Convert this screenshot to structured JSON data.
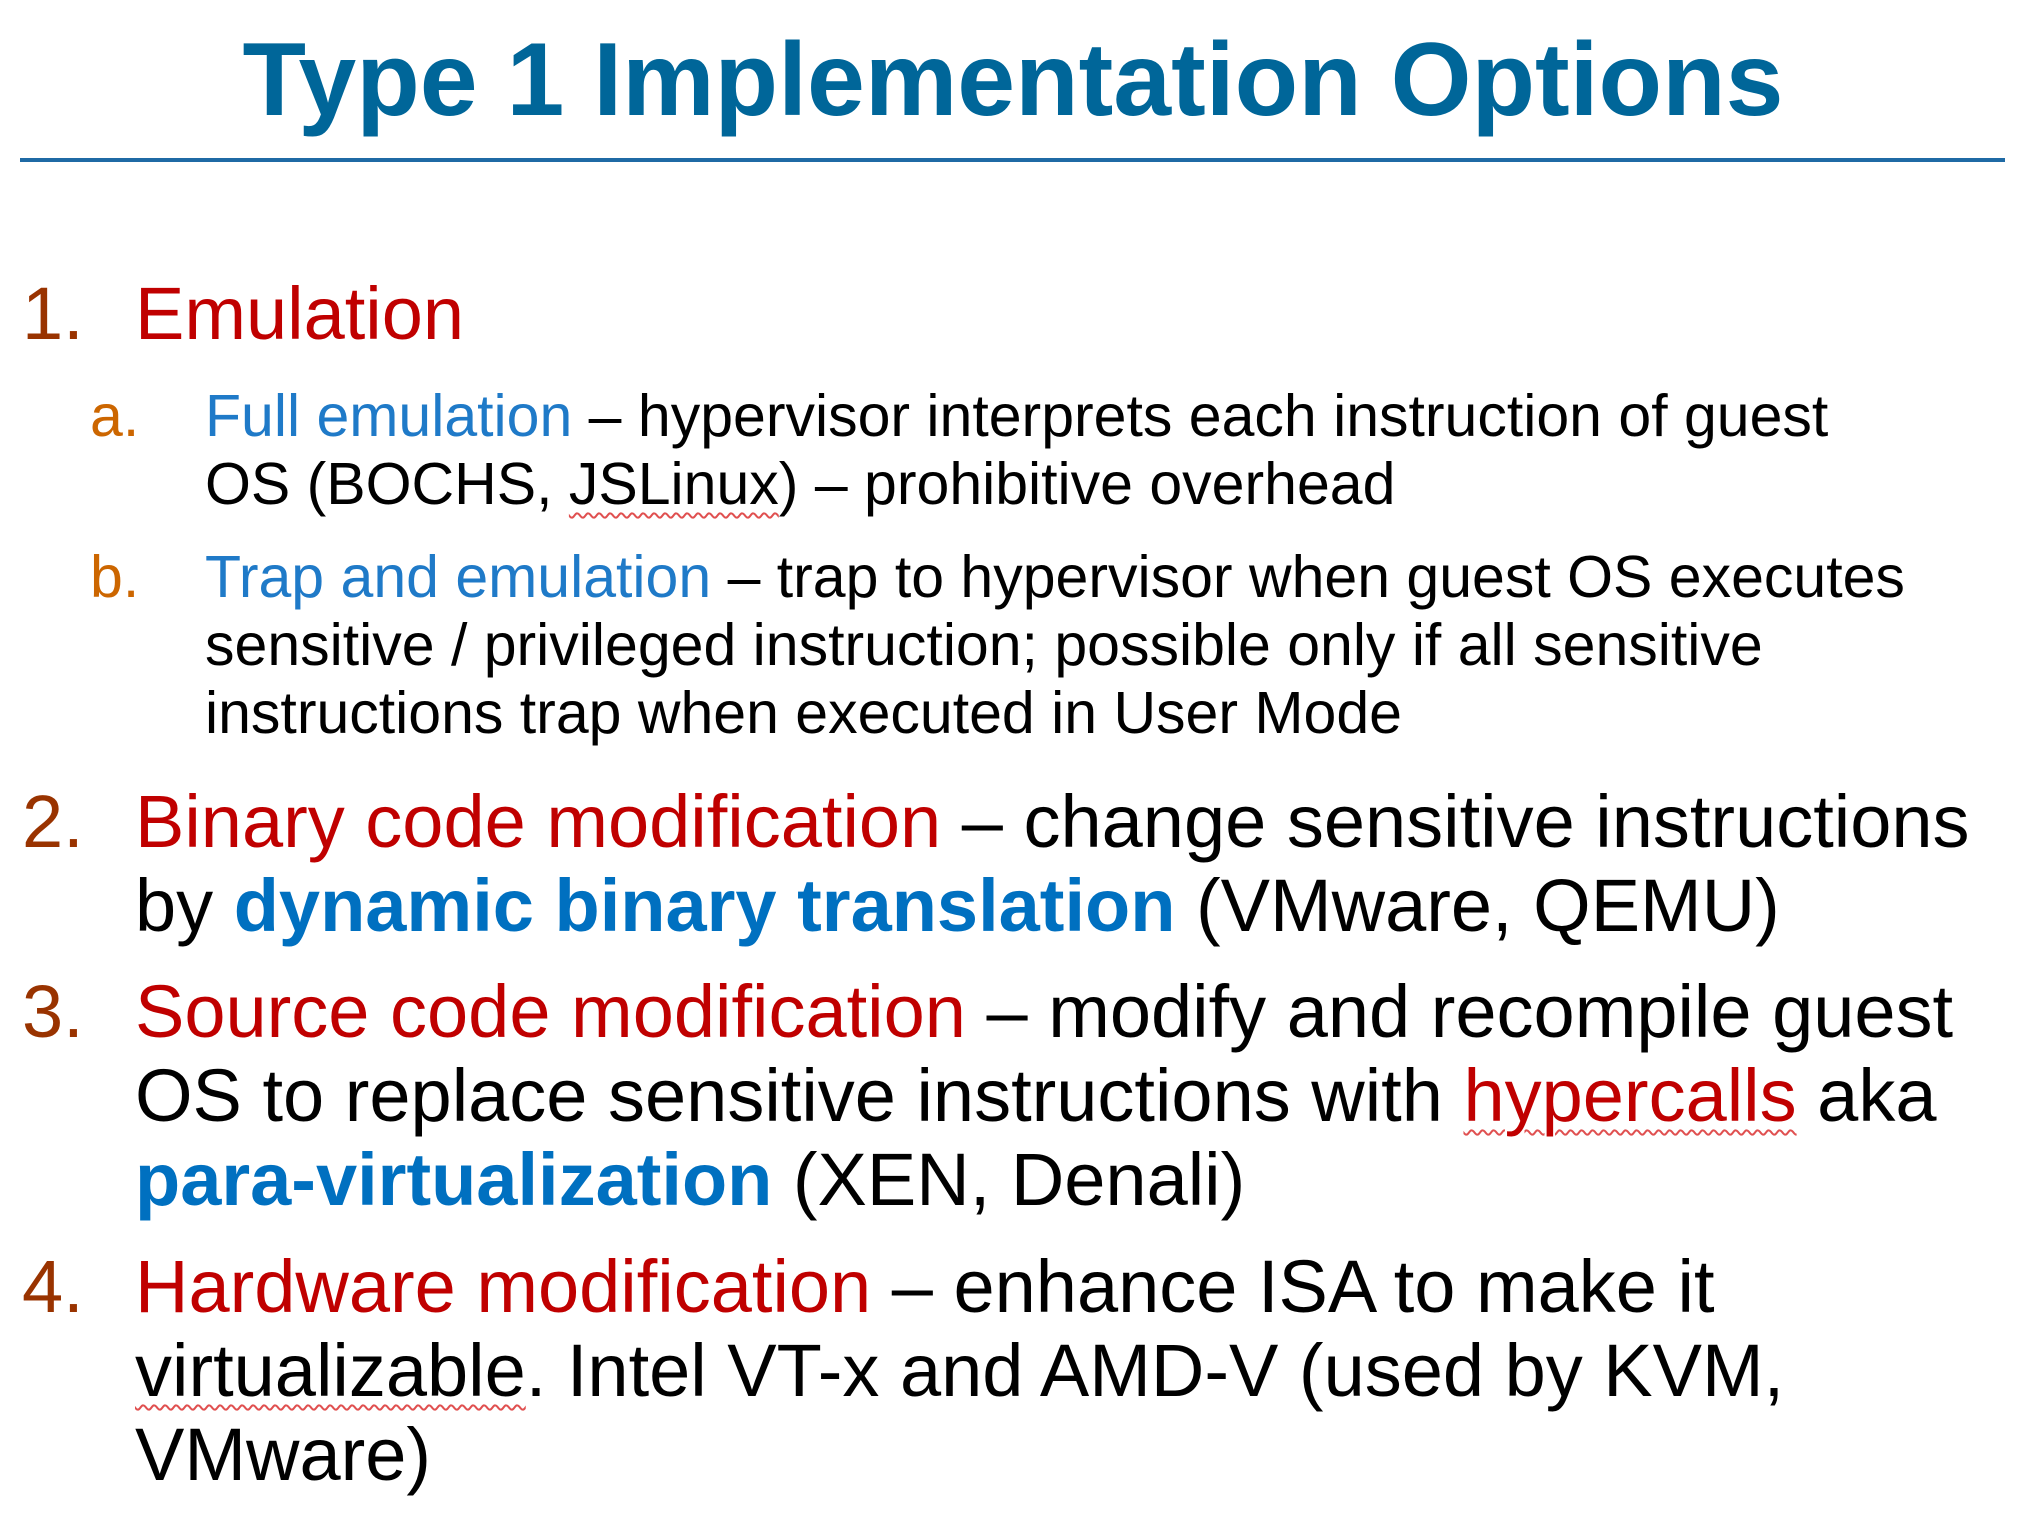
{
  "title": "Type 1 Implementation Options",
  "items": [
    {
      "number": "1.",
      "term": "Emulation",
      "subitems": [
        {
          "letter": "a.",
          "term": "Full emulation",
          "line1": " – hypervisor interprets each instruction of guest",
          "line2_a": "OS (BOCHS, ",
          "line2_jslinux": "JSLinux",
          "line2_b": ") – prohibitive overhead"
        },
        {
          "letter": "b.",
          "term": "Trap and emulation",
          "line1": " – trap to hypervisor when guest OS executes",
          "line2": "sensitive / privileged instruction; possible only if all sensitive",
          "line3": "instructions trap when executed in User Mode"
        }
      ]
    },
    {
      "number": "2.",
      "term": "Binary code modification",
      "line1": " – change sensitive instructions",
      "line2_a": "by ",
      "line2_highlight": "dynamic binary translation",
      "line2_b": " (VMware, QEMU)"
    },
    {
      "number": "3.",
      "term": "Source code modification",
      "line1": " – modify and recompile guest",
      "line2_a": "OS to replace sensitive instructions with ",
      "line2_hypercalls": "hypercalls",
      "line2_b": " aka",
      "line3_highlight": "para-virtualization",
      "line3_b": " (XEN, Denali)"
    },
    {
      "number": "4.",
      "term": "Hardware modification",
      "line1": " – enhance ISA to make it",
      "line2_virtualizable": "virtualizable",
      "line2_b": ". Intel VT-x and AMD-V (used by KVM,",
      "line3": "VMware)"
    }
  ],
  "colors": {
    "title": "#006699",
    "rule": "#1f6aa5",
    "number": "#993300",
    "letter": "#cc6600",
    "term": "#c00000",
    "sub_term": "#1f7ac8",
    "highlight": "#0070c0"
  }
}
